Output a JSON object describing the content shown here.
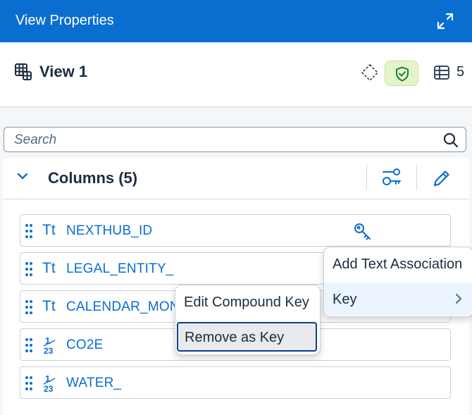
{
  "header": {
    "title": "View Properties"
  },
  "view": {
    "name": "View 1",
    "column_count": "5"
  },
  "search": {
    "placeholder": "Search",
    "value": ""
  },
  "columns": {
    "title": "Columns (5)",
    "rows": [
      {
        "type": "Tt",
        "name": "NEXTHUB_ID"
      },
      {
        "type": "Tt",
        "name": "LEGAL_ENTITY_"
      },
      {
        "type": "Tt",
        "name": "CALENDAR_MON"
      },
      {
        "type": "1.23",
        "name": "CO2E"
      },
      {
        "type": "1.23",
        "name": "WATER_"
      }
    ]
  },
  "context_menu": {
    "items": [
      "Add Text Association",
      "Key"
    ]
  },
  "submenu": {
    "items": [
      "Edit Compound Key",
      "Remove as Key"
    ]
  },
  "colors": {
    "brand": "#0a6ed1",
    "shield_bg": "#e5f4c8",
    "shield_icon": "#107e3e",
    "highlight": "#ebf4ff"
  },
  "icons": [
    "view-icon",
    "diamond-icon",
    "shield-icon",
    "table-icon",
    "search-icon",
    "chevron-down-icon",
    "compound-key-icon",
    "pencil-icon",
    "grip-icon",
    "key-icon",
    "expand-icon",
    "chevron-right-icon"
  ]
}
